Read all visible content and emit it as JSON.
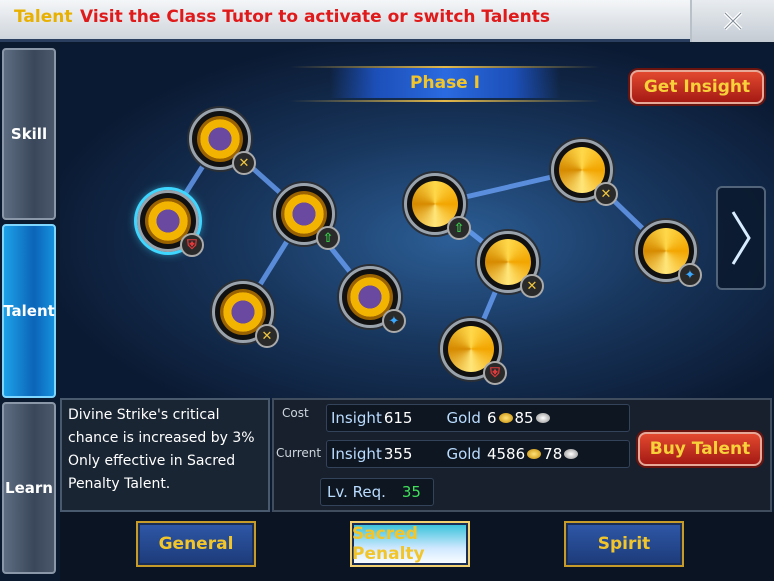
{
  "title": {
    "prefix": "Talent",
    "text": "Visit the Class Tutor to activate or switch Talents",
    "close_icon": "close-icon"
  },
  "side_tabs": [
    {
      "label": "Skill",
      "active": false
    },
    {
      "label": "Talent",
      "active": true
    },
    {
      "label": "Learn",
      "active": false
    }
  ],
  "phase": {
    "label": "Phase I"
  },
  "get_insight_label": "Get Insight",
  "nodes": [
    {
      "kind": "dark",
      "badge": "swords",
      "badge_icon": "crossed-swords-icon"
    },
    {
      "kind": "dark",
      "badge": "shield",
      "badge_icon": "shield-icon",
      "selected": true
    },
    {
      "kind": "dark",
      "badge": "up",
      "badge_icon": "up-arrow-icon"
    },
    {
      "kind": "dark",
      "badge": "swords",
      "badge_icon": "crossed-swords-icon"
    },
    {
      "kind": "dark",
      "badge": "star",
      "badge_icon": "star-icon"
    },
    {
      "kind": "gold",
      "badge": "up",
      "badge_icon": "up-arrow-icon"
    },
    {
      "kind": "gold",
      "badge": "swords",
      "badge_icon": "crossed-swords-icon"
    },
    {
      "kind": "gold",
      "badge": "swords",
      "badge_icon": "crossed-swords-icon"
    },
    {
      "kind": "gold",
      "badge": "shield",
      "badge_icon": "shield-icon"
    },
    {
      "kind": "gold",
      "badge": "star",
      "badge_icon": "star-icon"
    }
  ],
  "description": {
    "line1": "Divine Strike's critical",
    "line2": "chance is increased by 3%",
    "line3": "Only effective in Sacred",
    "line4": "Penalty Talent."
  },
  "cost": {
    "label": "Cost",
    "insight_label": "Insight",
    "insight": "615",
    "gold_label": "Gold",
    "gold": "6",
    "silver": "85"
  },
  "current": {
    "label": "Current",
    "insight_label": "Insight",
    "insight": "355",
    "gold_label": "Gold",
    "gold": "4586",
    "silver": "78"
  },
  "level_req": {
    "label": "Lv. Req.",
    "value": "35"
  },
  "buy_talent_label": "Buy Talent",
  "bottom_tabs": [
    {
      "label": "General",
      "active": false
    },
    {
      "label": "Sacred Penalty",
      "active": true
    },
    {
      "label": "Spirit",
      "active": false
    }
  ],
  "colors": {
    "accent_gold": "#f2c52a",
    "title_red": "#e01a1a",
    "active_tab": "#1da1e8",
    "req_green": "#3fe05a"
  }
}
